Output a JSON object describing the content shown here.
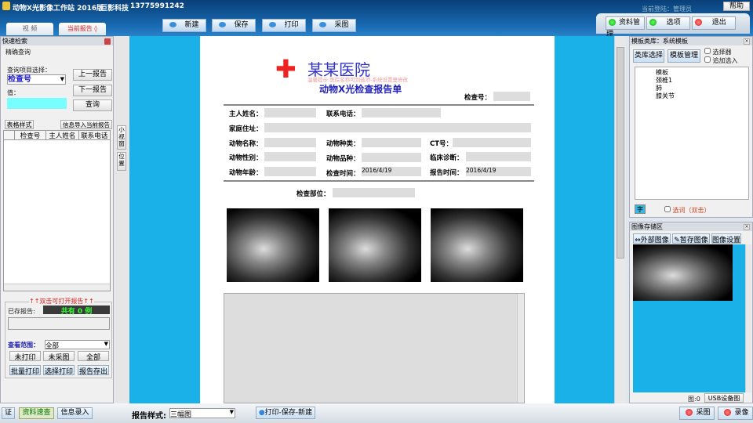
{
  "header": {
    "app_title": "动物X光影像工作站 2016版",
    "company": "巨影科技",
    "phone": "13775991242",
    "login": "当前登陆：管理员",
    "help": "帮助",
    "tabs": [
      {
        "label": "视 频"
      },
      {
        "label": "当前报告 ◊"
      }
    ],
    "toolbar": [
      {
        "label": "新建"
      },
      {
        "label": "保存"
      },
      {
        "label": "打印"
      },
      {
        "label": "采图"
      }
    ],
    "right_buttons": [
      {
        "label": "资料管理",
        "status": "green"
      },
      {
        "label": "选项",
        "status": "green"
      },
      {
        "label": "退出",
        "status": "red"
      }
    ]
  },
  "left": {
    "title": "快速检索",
    "group": "精确查询",
    "field_label": "查询项目选择：",
    "field_value": "检查号",
    "value_label": "值：",
    "value": "",
    "prev": "上一报告",
    "next": "下一报告",
    "query": "查询",
    "table_style": "表格样式",
    "import": "信息导入当前报告",
    "columns": [
      "检查号",
      "主人姓名",
      "联系电话"
    ],
    "hint": "↑↑双击可打开报告↑↑",
    "saved_label": "已存报告:",
    "saved_count": "共有 0 例",
    "range_label": "查看范围：",
    "range_value": "全部",
    "filters": [
      "未打印",
      "未采图",
      "全部"
    ],
    "actions": [
      "批量打印",
      "选择打印",
      "报告存出"
    ]
  },
  "side_tabs": [
    "小视窗",
    "位置"
  ],
  "report": {
    "hospital": "某某医院",
    "tip": "温馨提示:医院名称可到选项-系统设置里修改",
    "title": "动物X光检查报告单",
    "exam_no_label": "检查号：",
    "fields": {
      "owner": "主人姓名：",
      "phone": "联系电话：",
      "address": "家庭住址：",
      "animal_name": "动物名称：",
      "species": "动物种类：",
      "ct": "CT号：",
      "sex": "动物性别：",
      "breed": "动物品种：",
      "diagnosis": "临床诊断：",
      "age": "动物年龄：",
      "exam_time": "检查时间：",
      "exam_time_value": "2016/4/19",
      "report_time": "报告时间：",
      "report_time_value": "2016/4/19",
      "part": "检查部位："
    }
  },
  "right": {
    "template_title": "模板类库：系统模板",
    "lib_select": "类库选择",
    "tpl_manage": "模板管理",
    "selector": "选择器",
    "append": "追加选入",
    "tree": [
      "模板",
      "颈椎1",
      "肺",
      "膝关节"
    ],
    "font_btn": "字",
    "select_word": "选词（双击）",
    "image_title": "图像存储区",
    "external": "外部图像",
    "temp": "暂存图像",
    "img_settings": "图像设置",
    "img_count": "图:0",
    "usb": "USB设备图像"
  },
  "bottom": {
    "left_tabs": [
      "证",
      "资料速查",
      "信息录入"
    ],
    "style_label": "报告样式:",
    "style_value": "三幅图",
    "print_save_new": "打印-保存-新建",
    "capture": "采图",
    "record": "录像"
  }
}
